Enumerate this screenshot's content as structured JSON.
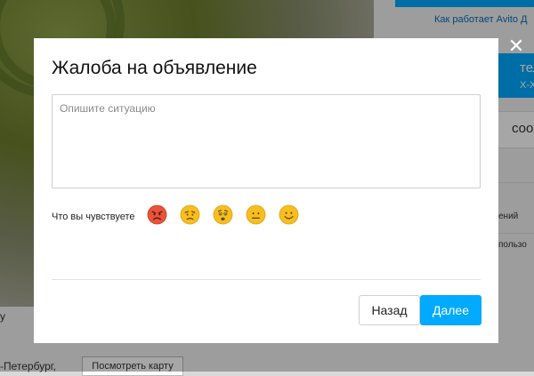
{
  "background": {
    "how_it_works_link": "Как работает Avito Д",
    "phone_button_line1": "телеф",
    "phone_button_line2": "X-XX-X",
    "message_button": "сообщ",
    "side_text_1": "ений",
    "side_text_2": "пользо",
    "left_fragment": "y",
    "city_text": "-Петербург,",
    "map_button": "Посмотреть карту"
  },
  "modal": {
    "title": "Жалоба на объявление",
    "description_placeholder": "Опишите ситуацию",
    "description_value": "",
    "feel_label": "Что вы чувствуете",
    "emotions": [
      {
        "name": "angry",
        "color": "#e8533b"
      },
      {
        "name": "sad",
        "color": "#f7be1f"
      },
      {
        "name": "worried",
        "color": "#f7be1f"
      },
      {
        "name": "neutral",
        "color": "#f7be1f"
      },
      {
        "name": "happy",
        "color": "#f7be1f"
      }
    ],
    "back_button": "Назад",
    "next_button": "Далее"
  },
  "colors": {
    "accent": "#00aaff",
    "link": "#0a69b8"
  }
}
